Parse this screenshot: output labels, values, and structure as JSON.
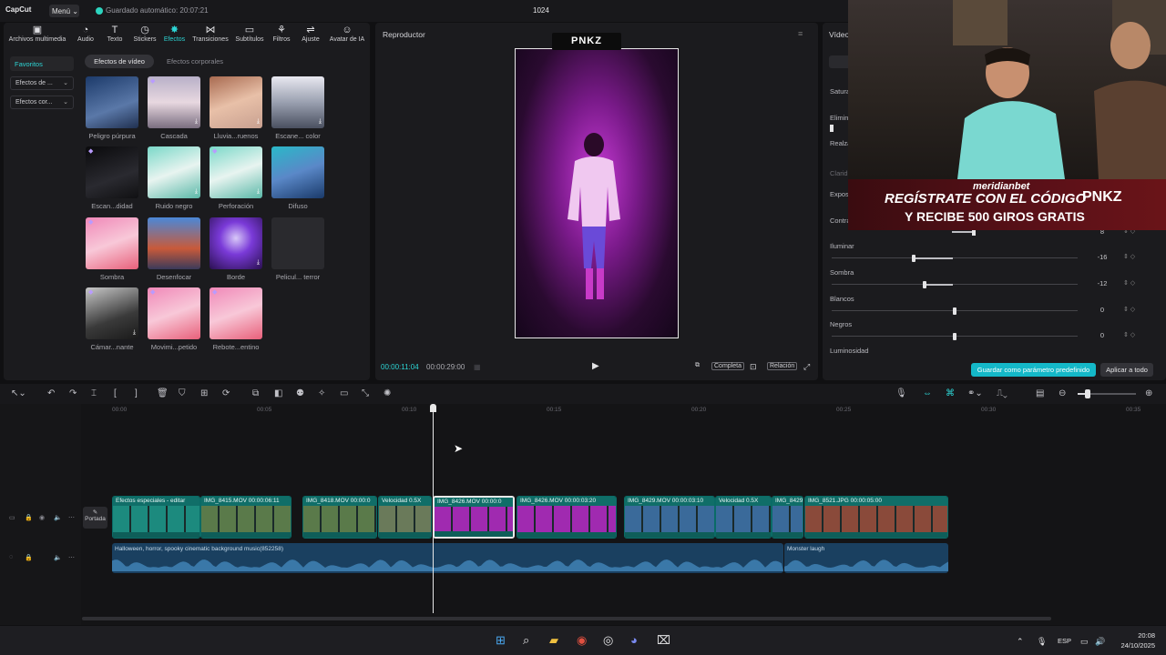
{
  "app": {
    "logo": "CapCut",
    "menu_label": "Menú",
    "autosave": "Guardado automático: 20:07:21",
    "project_name": "1024"
  },
  "toolbar": [
    {
      "label": "Archivos multimedia",
      "icon": "media-icon"
    },
    {
      "label": "Audio",
      "icon": "audio-icon"
    },
    {
      "label": "Texto",
      "icon": "text-icon"
    },
    {
      "label": "Stickers",
      "icon": "sticker-icon"
    },
    {
      "label": "Efectos",
      "icon": "effects-icon",
      "active": true
    },
    {
      "label": "Transiciones",
      "icon": "transitions-icon"
    },
    {
      "label": "Subtítulos",
      "icon": "captions-icon"
    },
    {
      "label": "Filtros",
      "icon": "filters-icon"
    },
    {
      "label": "Ajuste",
      "icon": "adjust-icon"
    },
    {
      "label": "Avatar de IA",
      "icon": "ai-avatar-icon"
    }
  ],
  "sidebar": {
    "favorites": "Favoritos",
    "dropdowns": [
      "Efectos de ...",
      "Efectos cor..."
    ]
  },
  "effects_tabs": [
    "Efectos de vídeo",
    "Efectos corporales"
  ],
  "effects": [
    {
      "label": "Peligro púrpura"
    },
    {
      "label": "Cascada"
    },
    {
      "label": "Lluvia...ruenos"
    },
    {
      "label": "Escane... color"
    },
    {
      "label": "Escan...didad"
    },
    {
      "label": "Ruido negro"
    },
    {
      "label": "Perforación"
    },
    {
      "label": "Difuso"
    },
    {
      "label": "Sombra"
    },
    {
      "label": "Desenfocar"
    },
    {
      "label": "Borde"
    },
    {
      "label": "Pelicul... terror"
    },
    {
      "label": "Cámar...nante"
    },
    {
      "label": "Movimi...petido"
    },
    {
      "label": "Rebote...entino"
    }
  ],
  "player": {
    "title": "Reproductor",
    "overlay_logo": "PNKZ",
    "current_time": "00:00:11:04",
    "total_time": "00:00:29:00",
    "complete_label": "Completa",
    "ratio_label": "Relación"
  },
  "right_panel": {
    "title": "Vídeo",
    "partial_labels": [
      "Satura",
      "Elimin",
      "Realza",
      "Clarid",
      "Expos",
      "Contra"
    ],
    "adjustments": [
      {
        "label": "Iluminar",
        "value": "-16",
        "level": 0.33
      },
      {
        "label": "Sombra",
        "value": "-12",
        "level": 0.375
      },
      {
        "label": "Blancos",
        "value": "0",
        "level": 0.5
      },
      {
        "label": "Negros",
        "value": "0",
        "level": 0.5
      },
      {
        "label": "Luminosidad",
        "value": "",
        "level": 0.5
      }
    ],
    "contrast_value": "8",
    "save_preset": "Guardar como parámetro predefinido",
    "apply_all": "Aplicar a todo"
  },
  "stream_overlay": {
    "brand": "meridianbet",
    "line1": "REGÍSTRATE CON EL CÓDIGO",
    "code": "PNKZ",
    "line2": "Y RECIBE 500 GIROS GRATIS"
  },
  "ruler": [
    "00:00",
    "00:05",
    "00:10",
    "00:15",
    "00:20",
    "00:25",
    "00:30",
    "00:35"
  ],
  "clips": [
    {
      "label": "Efectos especiales - editar",
      "color": "#1c8a7e"
    },
    {
      "label": "IMG_8415.MOV  00:00:06:11",
      "color": "#5a7a4a"
    },
    {
      "label": "IMG_8418.MOV  00:00:0",
      "color": "#5a7a4a"
    },
    {
      "label": "Velocidad 0.5X",
      "color": "#6a7a5a"
    },
    {
      "label": "IMG_8426.MOV  00:00:0",
      "color": "#a02ab0"
    },
    {
      "label": "IMG_8426.MOV  00:00:03:20",
      "color": "#a02ab0"
    },
    {
      "label": "IMG_8429.MOV  00:00:03:10",
      "color": "#3a6a9a"
    },
    {
      "label": "Velocidad 0.5X",
      "color": "#3a6a9a"
    },
    {
      "label": "IMG_8429.I",
      "color": "#3a6a9a"
    },
    {
      "label": "IMG_8521.JPG  00:00:05:00",
      "color": "#8a4a3a"
    }
  ],
  "cover_label": "Portada",
  "audio": [
    {
      "label": "Halloween, horror, spooky cinematic background music(852258)"
    },
    {
      "label": "Monster laugh"
    }
  ],
  "taskbar": {
    "lang": "ESP",
    "time": "20:08",
    "date": "24/10/2025"
  }
}
